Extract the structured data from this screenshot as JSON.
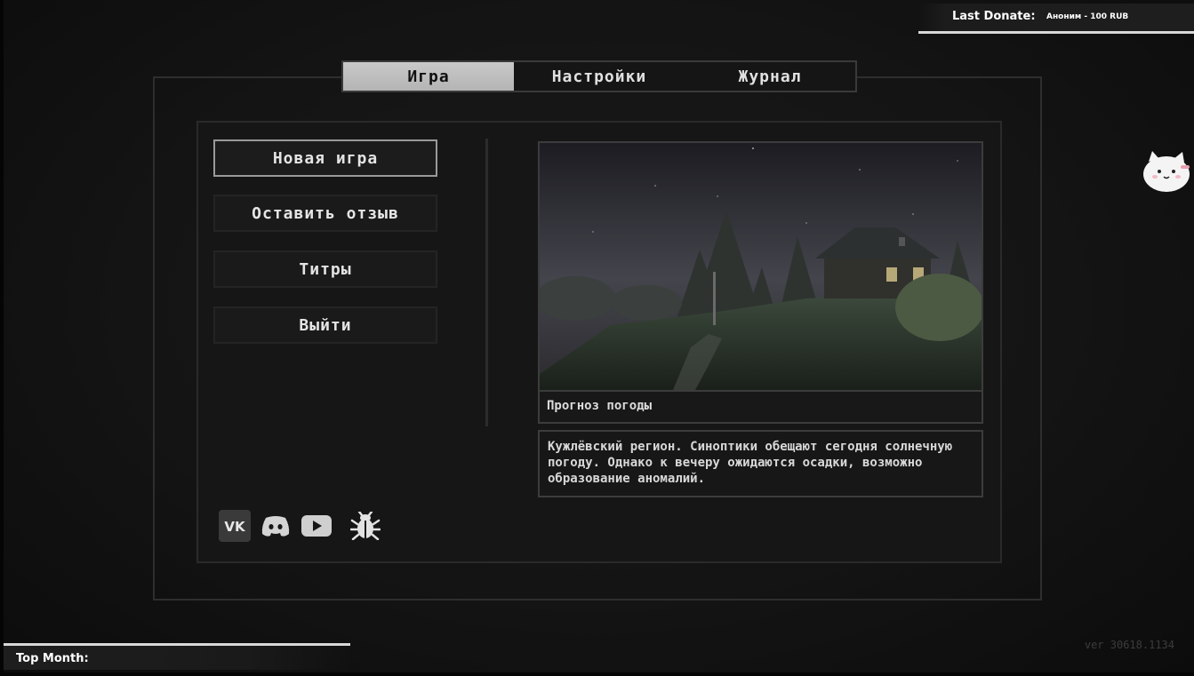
{
  "tabs": [
    {
      "label": "Игра",
      "active": true
    },
    {
      "label": "Настройки",
      "active": false
    },
    {
      "label": "Журнал",
      "active": false
    }
  ],
  "menu": {
    "items": [
      {
        "label": "Новая игра",
        "selected": true
      },
      {
        "label": "Оставить отзыв",
        "selected": false
      },
      {
        "label": "Титры",
        "selected": false
      },
      {
        "label": "Выйти",
        "selected": false
      }
    ]
  },
  "preview": {
    "caption": "Прогноз погоды",
    "description": "Кужлёвский регион. Синоптики обещают сегодня солнечную погоду. Однако к вечеру ожидаются осадки, возможно образование аномалий."
  },
  "social": {
    "vk_text": "VK",
    "icons": [
      "vk-icon",
      "discord-icon",
      "youtube-icon",
      "bug-icon"
    ]
  },
  "donate": {
    "label": "Last Donate:",
    "value": "Аноним - 100 RUB"
  },
  "top_month": {
    "label": "Top Month:"
  },
  "version": "ver 30618.1134",
  "colors": {
    "background": "#141414",
    "active_tab": "#c4c4c4",
    "border": "#3c3c3c",
    "text": "#e6e6e6"
  }
}
